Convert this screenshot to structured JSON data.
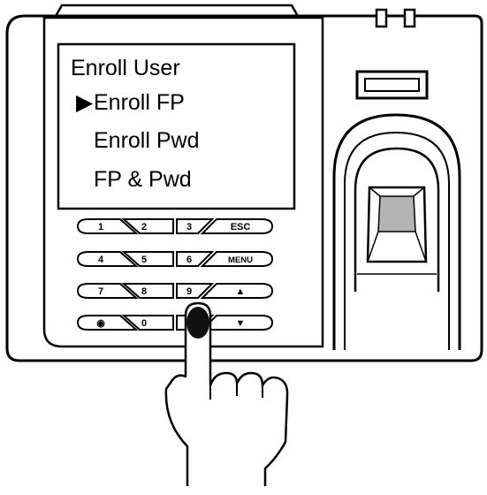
{
  "lcd": {
    "title": "Enroll User",
    "cursor_glyph": "▶",
    "items": [
      "Enroll FP",
      "Enroll Pwd",
      "FP & Pwd"
    ],
    "selected_index": 0
  },
  "keypad": {
    "rows": [
      [
        "1",
        "2",
        "3",
        "ESC"
      ],
      [
        "4",
        "5",
        "6",
        "MENU"
      ],
      [
        "7",
        "8",
        "9",
        "▲"
      ],
      [
        "◉",
        "0",
        "",
        "▼"
      ]
    ]
  }
}
